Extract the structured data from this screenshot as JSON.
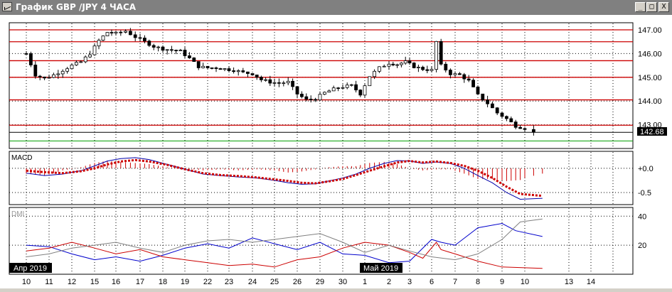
{
  "window": {
    "title": "График GBP /JPY  4 ЧАСА",
    "buttons": {
      "minimize": "_",
      "maximize": "□",
      "close": "X"
    }
  },
  "price_panel": {
    "current_price": "142.68",
    "ticks": [
      "147.00",
      "146.00",
      "145.00",
      "144.00",
      "143.00"
    ],
    "colors": {
      "level_lines": "#cc0000",
      "grid": "#000000",
      "candle_up": "#ffffff",
      "candle_down": "#000000"
    }
  },
  "macd_panel": {
    "label": "MACD",
    "ticks": [
      "+0.0",
      "-0.5"
    ],
    "colors": {
      "macd_line": "#0000aa",
      "signal_line": "#cc0000",
      "histogram": "#cc0000"
    }
  },
  "dmi_panel": {
    "label": "DMI",
    "ticks": [
      "40",
      "20"
    ],
    "colors": {
      "plus_di": "#0000cc",
      "minus_di": "#cc0000",
      "adx": "#808080"
    }
  },
  "xaxis": {
    "month_labels": [
      "Апр 2019",
      "Май 2019"
    ],
    "dates": [
      "10",
      "11",
      "12",
      "15",
      "16",
      "17",
      "18",
      "19",
      "22",
      "23",
      "24",
      "25",
      "26",
      "29",
      "30",
      "1",
      "2",
      "3",
      "6",
      "7",
      "8",
      "9",
      "10",
      "13",
      "14"
    ]
  },
  "chart_data": [
    {
      "type": "candlestick",
      "title": "",
      "xlabel": "",
      "ylabel": "",
      "ylim": [
        142.0,
        147.3
      ],
      "y_ticks": [
        147.0,
        146.0,
        145.0,
        144.0,
        143.0
      ],
      "horizontal_levels": [
        147.0,
        146.5,
        145.7,
        145.0,
        144.05,
        142.98
      ],
      "last_price": 142.68,
      "x_categories": [
        "10",
        "11",
        "12",
        "15",
        "16",
        "17",
        "18",
        "19",
        "22",
        "23",
        "24",
        "25",
        "26",
        "29",
        "30",
        "1",
        "2",
        "3",
        "6",
        "7",
        "8",
        "9",
        "10",
        "13",
        "14"
      ],
      "close_path": [
        [
          0,
          146.0
        ],
        [
          0.4,
          145.1
        ],
        [
          0.8,
          144.95
        ],
        [
          1.2,
          145.1
        ],
        [
          1.6,
          145.3
        ],
        [
          2.0,
          145.5
        ],
        [
          2.4,
          145.65
        ],
        [
          2.8,
          146.0
        ],
        [
          3.2,
          146.55
        ],
        [
          3.6,
          146.9
        ],
        [
          4.0,
          146.85
        ],
        [
          4.4,
          146.95
        ],
        [
          4.8,
          146.7
        ],
        [
          5.2,
          146.5
        ],
        [
          5.6,
          146.3
        ],
        [
          6.0,
          146.2
        ],
        [
          6.4,
          146.15
        ],
        [
          6.8,
          146.1
        ],
        [
          7.2,
          145.8
        ],
        [
          7.6,
          145.45
        ],
        [
          8.0,
          145.4
        ],
        [
          8.4,
          145.4
        ],
        [
          8.8,
          145.35
        ],
        [
          9.2,
          145.3
        ],
        [
          9.6,
          145.2
        ],
        [
          10.0,
          145.15
        ],
        [
          10.4,
          144.9
        ],
        [
          10.8,
          144.8
        ],
        [
          11.2,
          144.75
        ],
        [
          11.6,
          144.8
        ],
        [
          12.0,
          144.3
        ],
        [
          12.4,
          144.05
        ],
        [
          12.8,
          144.1
        ],
        [
          13.2,
          144.35
        ],
        [
          13.6,
          144.5
        ],
        [
          14.0,
          144.6
        ],
        [
          14.4,
          144.65
        ],
        [
          14.8,
          144.3
        ],
        [
          15.2,
          145.05
        ],
        [
          15.6,
          145.4
        ],
        [
          16.0,
          145.6
        ],
        [
          16.4,
          145.55
        ],
        [
          16.8,
          145.65
        ],
        [
          17.2,
          145.45
        ],
        [
          17.6,
          145.35
        ],
        [
          18.0,
          145.3
        ],
        [
          18.2,
          146.5
        ],
        [
          18.4,
          145.5
        ],
        [
          18.8,
          145.15
        ],
        [
          19.2,
          145.1
        ],
        [
          19.6,
          144.85
        ],
        [
          20.0,
          144.25
        ],
        [
          20.4,
          143.9
        ],
        [
          20.8,
          143.5
        ],
        [
          21.2,
          143.25
        ],
        [
          21.6,
          142.95
        ],
        [
          22.0,
          142.85
        ],
        [
          22.2,
          142.68
        ]
      ]
    },
    {
      "type": "line",
      "title": "",
      "xlabel": "",
      "ylabel": "",
      "ylim": [
        -0.75,
        0.35
      ],
      "y_ticks": [
        0.0,
        -0.5
      ],
      "series": [
        {
          "values_xy": [
            [
              0,
              -0.1
            ],
            [
              0.8,
              -0.15
            ],
            [
              1.6,
              -0.12
            ],
            [
              2.4,
              -0.05
            ],
            [
              3.0,
              0.05
            ],
            [
              3.6,
              0.15
            ],
            [
              4.2,
              0.2
            ],
            [
              4.8,
              0.22
            ],
            [
              5.4,
              0.18
            ],
            [
              6.2,
              0.08
            ],
            [
              7.0,
              -0.02
            ],
            [
              7.8,
              -0.12
            ],
            [
              8.6,
              -0.15
            ],
            [
              9.4,
              -0.18
            ],
            [
              10.2,
              -0.2
            ],
            [
              11.0,
              -0.25
            ],
            [
              11.6,
              -0.3
            ],
            [
              12.2,
              -0.33
            ],
            [
              12.8,
              -0.32
            ],
            [
              13.4,
              -0.26
            ],
            [
              14.0,
              -0.2
            ],
            [
              14.6,
              -0.12
            ],
            [
              15.2,
              0.0
            ],
            [
              15.8,
              0.1
            ],
            [
              16.4,
              0.16
            ],
            [
              17.0,
              0.15
            ],
            [
              17.6,
              0.1
            ],
            [
              18.2,
              0.13
            ],
            [
              18.8,
              0.1
            ],
            [
              19.4,
              0.0
            ],
            [
              20.0,
              -0.15
            ],
            [
              20.6,
              -0.3
            ],
            [
              21.2,
              -0.5
            ],
            [
              21.8,
              -0.64
            ],
            [
              22.4,
              -0.62
            ]
          ]
        },
        {
          "values_xy": [
            [
              0,
              -0.05
            ],
            [
              0.8,
              -0.08
            ],
            [
              1.6,
              -0.1
            ],
            [
              2.4,
              -0.06
            ],
            [
              3.0,
              0.0
            ],
            [
              3.6,
              0.08
            ],
            [
              4.2,
              0.14
            ],
            [
              4.8,
              0.17
            ],
            [
              5.4,
              0.14
            ],
            [
              6.2,
              0.07
            ],
            [
              7.0,
              -0.02
            ],
            [
              7.8,
              -0.1
            ],
            [
              8.6,
              -0.14
            ],
            [
              9.4,
              -0.16
            ],
            [
              10.2,
              -0.19
            ],
            [
              11.0,
              -0.23
            ],
            [
              11.6,
              -0.26
            ],
            [
              12.2,
              -0.3
            ],
            [
              12.8,
              -0.31
            ],
            [
              13.4,
              -0.27
            ],
            [
              14.0,
              -0.22
            ],
            [
              14.6,
              -0.14
            ],
            [
              15.2,
              -0.05
            ],
            [
              15.8,
              0.04
            ],
            [
              16.4,
              0.12
            ],
            [
              17.0,
              0.15
            ],
            [
              17.6,
              0.12
            ],
            [
              18.2,
              0.14
            ],
            [
              18.8,
              0.11
            ],
            [
              19.4,
              0.05
            ],
            [
              20.0,
              -0.05
            ],
            [
              20.6,
              -0.2
            ],
            [
              21.2,
              -0.38
            ],
            [
              21.8,
              -0.53
            ],
            [
              22.4,
              -0.57
            ]
          ]
        }
      ]
    },
    {
      "type": "line",
      "title": "",
      "xlabel": "",
      "ylabel": "",
      "ylim": [
        0,
        46
      ],
      "y_ticks": [
        40,
        20
      ],
      "series": [
        {
          "values_xy": [
            [
              0,
              20
            ],
            [
              1,
              19
            ],
            [
              2,
              14
            ],
            [
              3,
              10
            ],
            [
              4,
              12
            ],
            [
              5,
              9
            ],
            [
              6,
              13
            ],
            [
              7,
              18
            ],
            [
              8,
              21
            ],
            [
              9,
              18
            ],
            [
              10,
              25
            ],
            [
              11,
              21
            ],
            [
              12,
              17
            ],
            [
              13,
              22
            ],
            [
              14,
              14
            ],
            [
              15,
              13
            ],
            [
              16,
              8
            ],
            [
              17,
              9
            ],
            [
              18,
              24
            ],
            [
              18.4,
              22
            ],
            [
              19,
              20
            ],
            [
              20,
              32
            ],
            [
              21,
              35
            ],
            [
              21.6,
              30
            ],
            [
              22.4,
              26
            ]
          ]
        },
        {
          "values_xy": [
            [
              0,
              16
            ],
            [
              1,
              18
            ],
            [
              2,
              22
            ],
            [
              3,
              18
            ],
            [
              4,
              14
            ],
            [
              5,
              17
            ],
            [
              6,
              12
            ],
            [
              7,
              10
            ],
            [
              8,
              8
            ],
            [
              9,
              6
            ],
            [
              10,
              7
            ],
            [
              11,
              5
            ],
            [
              12,
              10
            ],
            [
              13,
              12
            ],
            [
              14,
              18
            ],
            [
              15,
              22
            ],
            [
              16,
              20
            ],
            [
              17,
              15
            ],
            [
              17.6,
              11
            ],
            [
              18.2,
              22
            ],
            [
              18.4,
              17
            ],
            [
              19,
              14
            ],
            [
              20,
              9
            ],
            [
              21,
              5
            ],
            [
              22.4,
              4
            ]
          ]
        },
        {
          "values_xy": [
            [
              0,
              12
            ],
            [
              1,
              14
            ],
            [
              2,
              18
            ],
            [
              3,
              20
            ],
            [
              4,
              22
            ],
            [
              5,
              18
            ],
            [
              6,
              15
            ],
            [
              7,
              20
            ],
            [
              8,
              23
            ],
            [
              9,
              24
            ],
            [
              10,
              22
            ],
            [
              11,
              24
            ],
            [
              12,
              26
            ],
            [
              13,
              28
            ],
            [
              14,
              22
            ],
            [
              15,
              15
            ],
            [
              16,
              20
            ],
            [
              17,
              16
            ],
            [
              18,
              12
            ],
            [
              19,
              10
            ],
            [
              20,
              14
            ],
            [
              21,
              24
            ],
            [
              21.8,
              36
            ],
            [
              22.4,
              38
            ]
          ]
        }
      ]
    }
  ]
}
